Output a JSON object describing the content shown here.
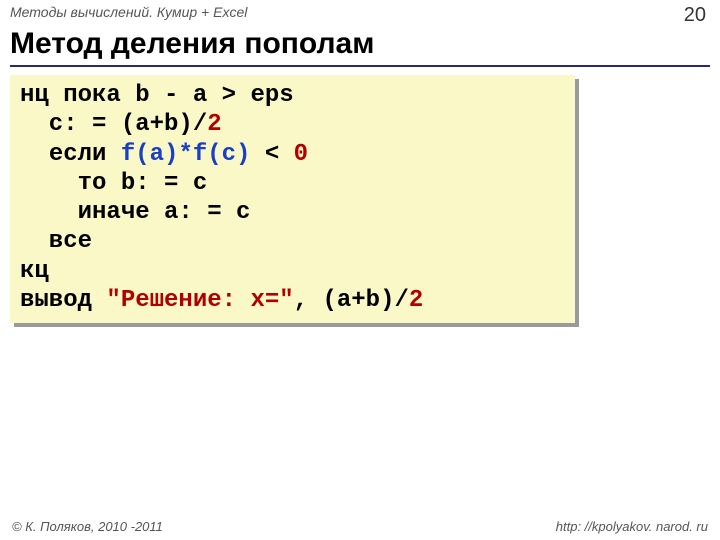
{
  "header": {
    "course": "Методы вычислений. Кумир + Excel",
    "page": "20"
  },
  "title": "Метод деления пополам",
  "code": {
    "l1_kw": "нц пока",
    "l1_rest": " b - a > eps ",
    "l2": "  c: = (a+b)/",
    "l2_num": "2",
    "l3a": "  ",
    "l3_kw": "если",
    "l3b": " ",
    "l3_fn": "f(a)*f(c)",
    "l3c": " < ",
    "l3_num": "0",
    "l4_kw": "    то",
    "l4_rest": " b: = c ",
    "l5_kw": "    иначе",
    "l5_rest": " a: = c ",
    "l6_kw": "  все",
    "l7_kw": "кц",
    "l8_kw": "вывод",
    "l8_sp": " ",
    "l8_str": "\"Решение: x=\"",
    "l8_rest": ", (a+b)/",
    "l8_num": "2"
  },
  "footer": {
    "copyright": "© К. Поляков, 2010 -2011",
    "url": "http: //kpolyakov. narod. ru"
  }
}
